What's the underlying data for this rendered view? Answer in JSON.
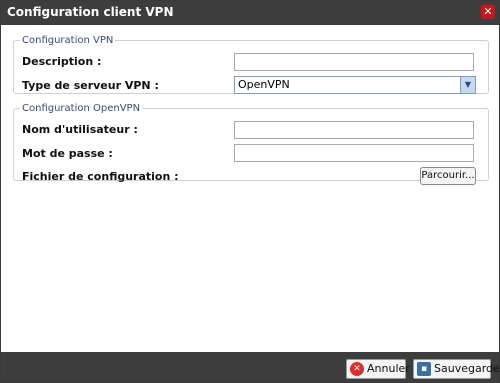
{
  "dialog": {
    "title": "Configuration client VPN",
    "close_icon": "close-icon"
  },
  "vpn_section": {
    "legend": "Configuration VPN",
    "description_label": "Description :",
    "description_value": "",
    "server_type_label": "Type de serveur VPN :",
    "server_type_value": "OpenVPN"
  },
  "openvpn_section": {
    "legend": "Configuration OpenVPN",
    "username_label": "Nom d'utilisateur :",
    "username_value": "",
    "password_label": "Mot de passe :",
    "password_value": "",
    "config_file_label": "Fichier de configuration :",
    "browse_label": "Parcourir..."
  },
  "footer": {
    "cancel_label": "Annuler",
    "save_label": "Sauvegarder"
  }
}
